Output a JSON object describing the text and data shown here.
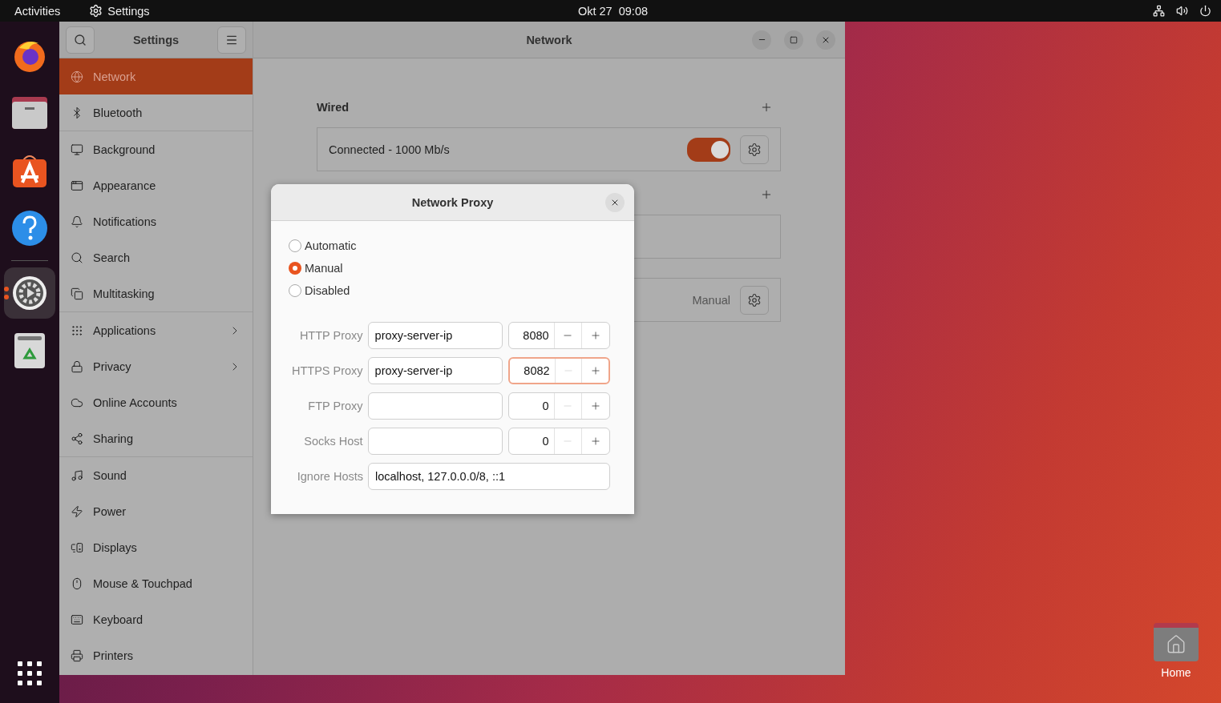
{
  "top_bar": {
    "activities": "Activities",
    "app_name": "Settings",
    "clock": "Okt 27  09:08"
  },
  "dock": {
    "items": [
      {
        "active": false
      },
      {
        "active": false
      },
      {
        "active": false
      },
      {
        "active": false
      },
      {
        "active": true
      },
      {
        "active": false
      }
    ]
  },
  "desktop": {
    "icons": [
      {
        "label": "Home"
      }
    ]
  },
  "sidebar": {
    "title": "Settings",
    "groups": [
      [
        {
          "label": "Network",
          "selected": true,
          "chevron": false
        },
        {
          "label": "Bluetooth",
          "selected": false,
          "chevron": false
        }
      ],
      [
        {
          "label": "Background",
          "selected": false,
          "chevron": false
        },
        {
          "label": "Appearance",
          "selected": false,
          "chevron": false
        },
        {
          "label": "Notifications",
          "selected": false,
          "chevron": false
        },
        {
          "label": "Search",
          "selected": false,
          "chevron": false
        },
        {
          "label": "Multitasking",
          "selected": false,
          "chevron": false
        }
      ],
      [
        {
          "label": "Applications",
          "selected": false,
          "chevron": true
        },
        {
          "label": "Privacy",
          "selected": false,
          "chevron": true
        },
        {
          "label": "Online Accounts",
          "selected": false,
          "chevron": false
        },
        {
          "label": "Sharing",
          "selected": false,
          "chevron": false
        }
      ],
      [
        {
          "label": "Sound",
          "selected": false,
          "chevron": false
        },
        {
          "label": "Power",
          "selected": false,
          "chevron": false
        },
        {
          "label": "Displays",
          "selected": false,
          "chevron": false
        },
        {
          "label": "Mouse & Touchpad",
          "selected": false,
          "chevron": false
        },
        {
          "label": "Keyboard",
          "selected": false,
          "chevron": false
        },
        {
          "label": "Printers",
          "selected": false,
          "chevron": false
        }
      ]
    ]
  },
  "main": {
    "title": "Network",
    "sections": [
      {
        "title": "Wired",
        "add": true,
        "rows": [
          {
            "kind": "toggle",
            "text": "Connected - 1000 Mb/s",
            "on": true
          }
        ]
      },
      {
        "add": true,
        "rows": [
          {
            "kind": "blank"
          }
        ]
      },
      {
        "add": false,
        "rows": [
          {
            "kind": "status",
            "status": "Manual"
          }
        ]
      }
    ]
  },
  "dialog": {
    "title": "Network Proxy",
    "modes": [
      {
        "label": "Automatic",
        "selected": false
      },
      {
        "label": "Manual",
        "selected": true
      },
      {
        "label": "Disabled",
        "selected": false
      }
    ],
    "rows": [
      {
        "kind": "proxy",
        "label": "HTTP Proxy",
        "host": "proxy-server-ip",
        "port": "8080",
        "focused": false,
        "minus_disabled": false
      },
      {
        "kind": "proxy",
        "label": "HTTPS Proxy",
        "host": "proxy-server-ip",
        "port": "8082",
        "focused": true,
        "minus_disabled": true
      },
      {
        "kind": "proxy",
        "label": "FTP Proxy",
        "port": "0",
        "focused": false,
        "minus_disabled": true
      },
      {
        "kind": "proxy",
        "label": "Socks Host",
        "port": "0",
        "focused": false,
        "minus_disabled": true
      },
      {
        "kind": "hosts",
        "label": "Ignore Hosts",
        "host": "localhost, 127.0.0.0/8, ::1"
      }
    ]
  }
}
